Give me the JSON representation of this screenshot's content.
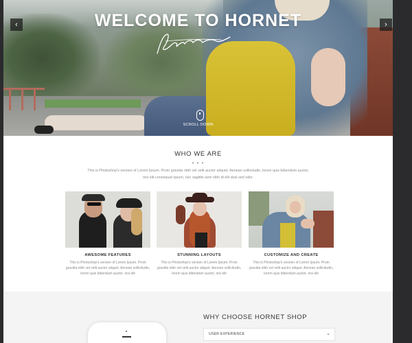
{
  "hero": {
    "title": "WELCOME TO HORNET",
    "prev_arrow": "‹",
    "next_arrow": "›",
    "scroll_label": "SCROLL DOWN"
  },
  "who": {
    "title": "WHO WE ARE",
    "dots": "• • •",
    "intro": "This is Photoshop's version of Lorem Ipsum. Proin gravida nibh vel velit auctor aliquet. Aenean sollicitudin, lorem quis bibendum auctor, nisi elit consequat ipsum, nec sagittis sem nibh id elit duis sed odio."
  },
  "features": [
    {
      "title": "AWESOME FEATURES",
      "desc": "This is Photoshop's version of Lorem Ipsum. Proin gravida nibh vel velit auctor aliquet. Aenean sollicitudin, lorem quis bibendum auctor, nisi elit"
    },
    {
      "title": "STUNNING LAYOUTS",
      "desc": "This is Photoshop's version of Lorem Ipsum. Proin gravida nibh vel velit auctor aliquet. Aenean sollicitudin, lorem quis bibendum auctor, nisi elit"
    },
    {
      "title": "CUSTOMIZE AND CREATE",
      "desc": "This is Photoshop's version of Lorem Ipsum. Proin gravida nibh vel velit auctor aliquet. Aenean sollicitudin, lorem quis bibendum auctor, nisi elit"
    }
  ],
  "why": {
    "title": "WHY CHOOSE HORNET SHOP",
    "accordion_label": "USER EXPERIENCE",
    "accordion_icon": "chevron-down-icon"
  },
  "colors": {
    "background": "#2b2b2d",
    "page": "#ffffff",
    "section_alt": "#f4f4f4",
    "heading": "#333333",
    "body_text": "#8a8a8a"
  }
}
